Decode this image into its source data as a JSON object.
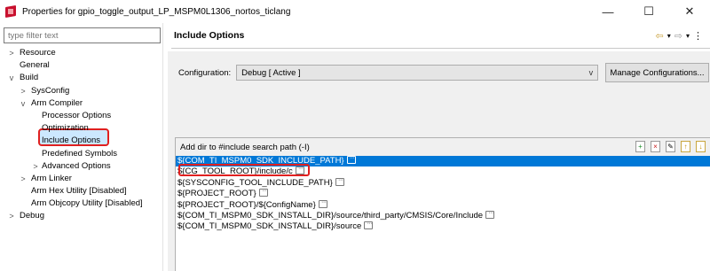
{
  "window": {
    "title": "Properties for gpio_toggle_output_LP_MSPM0L1306_nortos_ticlang",
    "controls": {
      "minimize": "—",
      "maximize": "☐",
      "close": "✕"
    }
  },
  "colors": {
    "accent": "#0078d7",
    "highlight": "#e02020",
    "brand": "#c8102e"
  },
  "sidebar": {
    "filter_placeholder": "type filter text",
    "items": [
      {
        "label": "Resource",
        "twisty": ">"
      },
      {
        "label": "General",
        "twisty": ""
      },
      {
        "label": "Build",
        "twisty": "v"
      },
      {
        "label": "SysConfig",
        "twisty": ">"
      },
      {
        "label": "Arm Compiler",
        "twisty": "v"
      },
      {
        "label": "Processor Options",
        "twisty": ""
      },
      {
        "label": "Optimization",
        "twisty": ""
      },
      {
        "label": "Include Options",
        "twisty": ""
      },
      {
        "label": "Predefined Symbols",
        "twisty": ""
      },
      {
        "label": "Advanced Options",
        "twisty": ">"
      },
      {
        "label": "Arm Linker",
        "twisty": ">"
      },
      {
        "label": "Arm Hex Utility  [Disabled]",
        "twisty": ""
      },
      {
        "label": "Arm Objcopy Utility  [Disabled]",
        "twisty": ""
      },
      {
        "label": "Debug",
        "twisty": ">"
      }
    ]
  },
  "main": {
    "title": "Include Options",
    "nav": {
      "back": "⇦",
      "back_menu": "▾",
      "forward": "⇨",
      "forward_menu": "▾",
      "menu": "⋮"
    },
    "configuration": {
      "label": "Configuration:",
      "value": "Debug  [ Active ]",
      "arrow": "v",
      "manage_button": "Manage Configurations..."
    },
    "include_paths": {
      "title": "Add dir to #include search path (-I)",
      "toolbar": {
        "add": "+",
        "delete": "×",
        "edit": "✎",
        "move_up": "↑",
        "move_down": "↓"
      },
      "items": [
        "${COM_TI_MSPM0_SDK_INCLUDE_PATH}",
        "${CG_TOOL_ROOT}/include/c",
        "${SYSCONFIG_TOOL_INCLUDE_PATH}",
        "${PROJECT_ROOT}",
        "${PROJECT_ROOT}/${ConfigName}",
        "${COM_TI_MSPM0_SDK_INSTALL_DIR}/source/third_party/CMSIS/Core/Include",
        "${COM_TI_MSPM0_SDK_INSTALL_DIR}/source"
      ]
    }
  }
}
